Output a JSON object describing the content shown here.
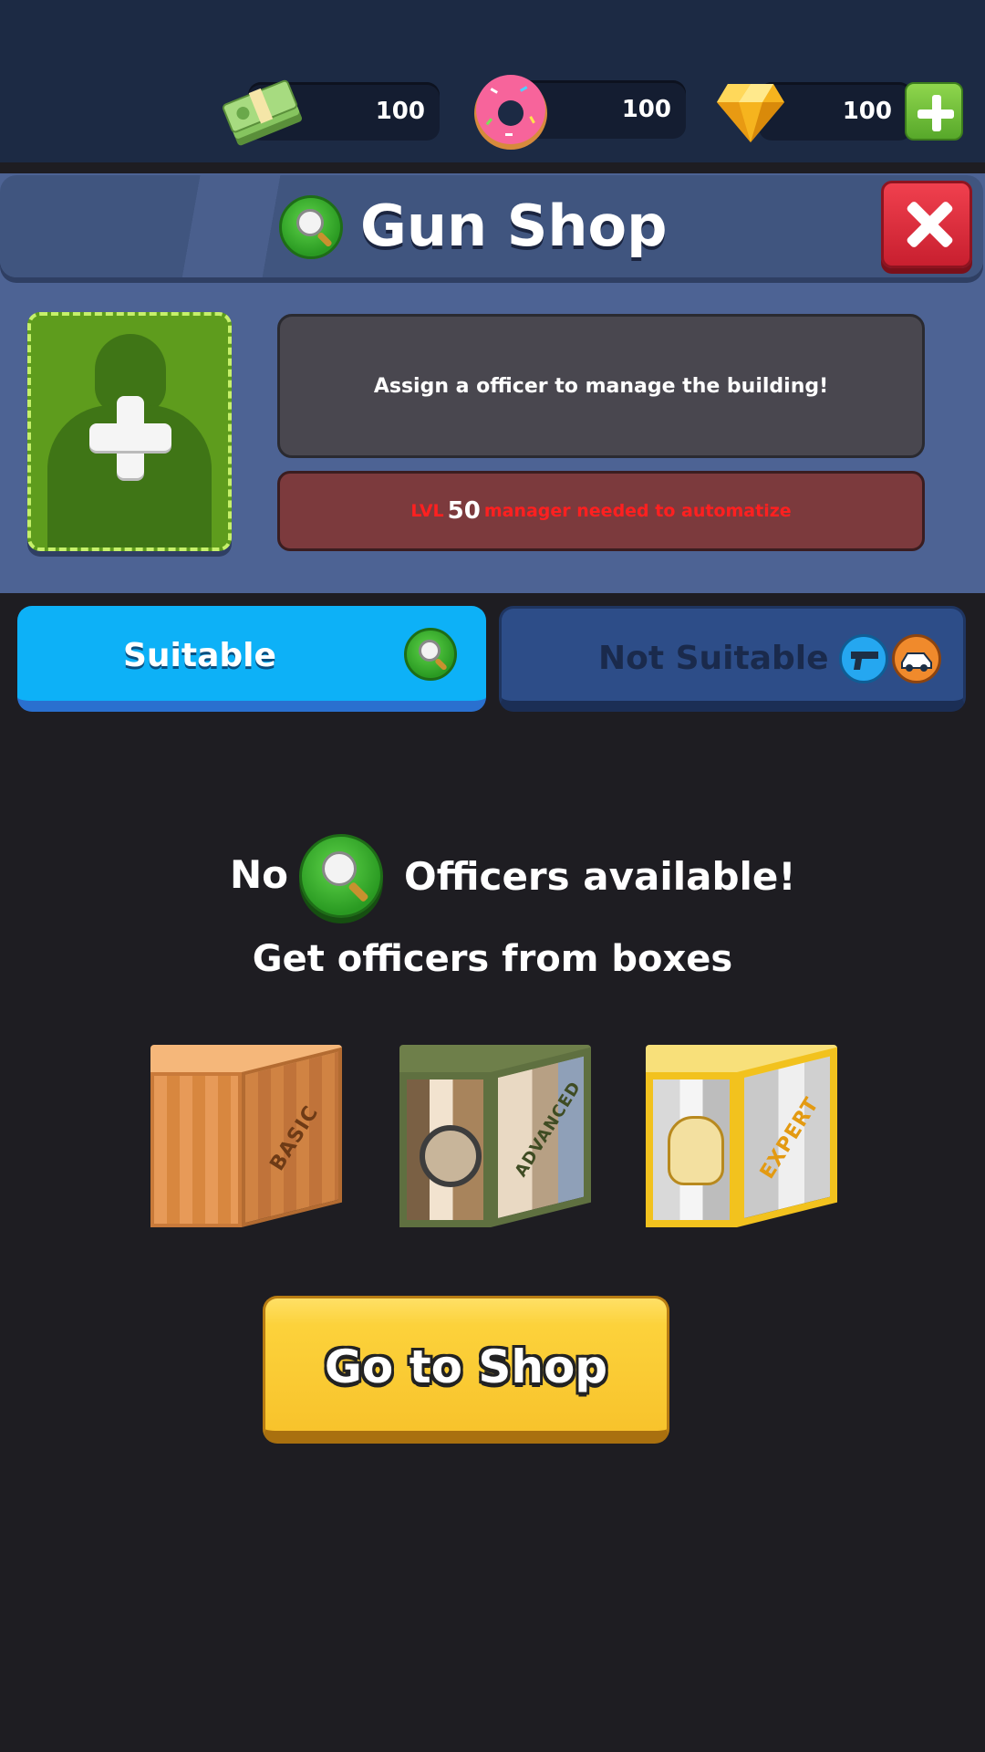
{
  "currencies": {
    "cash": {
      "icon": "cash-stack-icon",
      "value": "100"
    },
    "donuts": {
      "icon": "donut-icon",
      "value": "100"
    },
    "gems": {
      "icon": "gem-icon",
      "value": "100"
    }
  },
  "header": {
    "title": "Gun Shop",
    "icon": "search-badge-icon"
  },
  "assignment": {
    "message": "Assign a officer to manage the building!",
    "requirement_prefix": "LVL",
    "requirement_level": "50",
    "requirement_suffix": "manager needed to automatize"
  },
  "tabs": {
    "suitable_label": "Suitable",
    "not_suitable_label": "Not Suitable"
  },
  "empty_state": {
    "prefix": "No",
    "suffix": "Officers available!",
    "subtitle": "Get officers from boxes"
  },
  "boxes": [
    {
      "label": "BASIC"
    },
    {
      "label": "ADVANCED"
    },
    {
      "label": "EXPERT"
    }
  ],
  "shop_button_label": "Go to Shop",
  "colors": {
    "accent_blue": "#0db1f7",
    "button_yellow": "#fcd23b",
    "close_red": "#e23040"
  }
}
